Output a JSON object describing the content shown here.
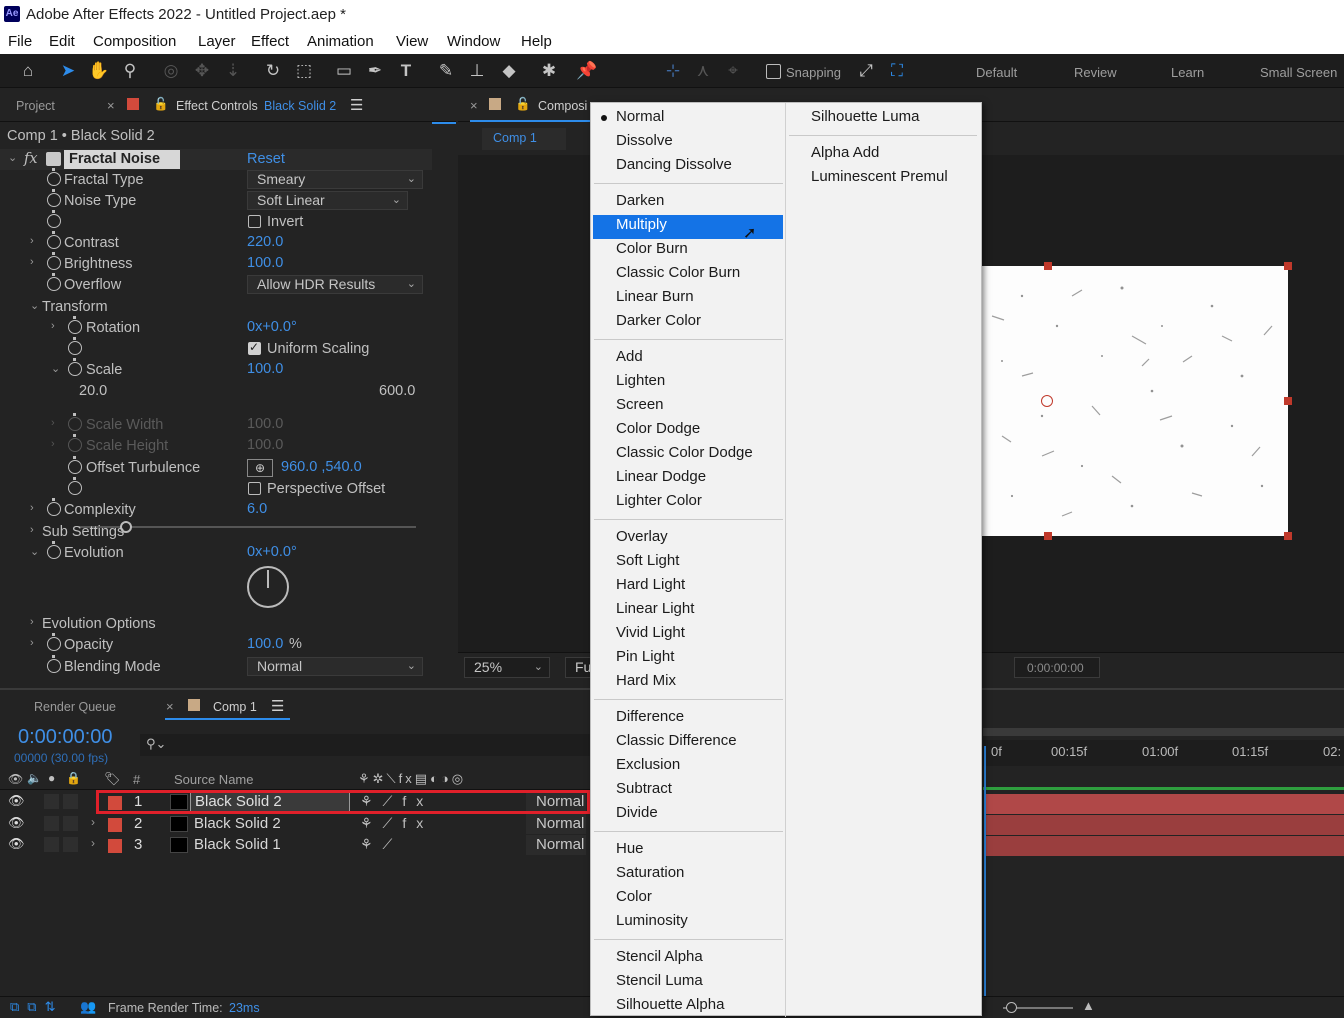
{
  "app": {
    "title": "Adobe After Effects 2022 - Untitled Project.aep *",
    "logo": "Ae"
  },
  "menubar": [
    "File",
    "Edit",
    "Composition",
    "Layer",
    "Effect",
    "Animation",
    "View",
    "Window",
    "Help"
  ],
  "toolbar": {
    "snapping_label": "Snapping",
    "workspaces": [
      "Default",
      "Review",
      "Learn",
      "Small Screen"
    ]
  },
  "left_tabs": {
    "project": "Project",
    "effect_controls": "Effect Controls",
    "effect_controls_layer": "Black Solid 2"
  },
  "comp_tabs": {
    "composition": "Composi",
    "comp1": "Comp 1"
  },
  "effect_controls": {
    "breadcrumb": "Comp 1 • Black Solid 2",
    "effect_name": "Fractal Noise",
    "reset": "Reset",
    "fractal_type": {
      "label": "Fractal Type",
      "value": "Smeary"
    },
    "noise_type": {
      "label": "Noise Type",
      "value": "Soft Linear"
    },
    "invert": {
      "label": "Invert",
      "checked": false
    },
    "contrast": {
      "label": "Contrast",
      "value": "220.0"
    },
    "brightness": {
      "label": "Brightness",
      "value": "100.0"
    },
    "overflow": {
      "label": "Overflow",
      "value": "Allow HDR Results"
    },
    "transform": {
      "label": "Transform"
    },
    "rotation": {
      "label": "Rotation",
      "value": "0x+0.0°"
    },
    "uniform_scaling": {
      "label": "Uniform Scaling",
      "checked": true
    },
    "scale": {
      "label": "Scale",
      "value": "100.0",
      "min": "20.0",
      "max": "600.0",
      "level": 0.14
    },
    "scale_width": {
      "label": "Scale Width",
      "value": "100.0"
    },
    "scale_height": {
      "label": "Scale Height",
      "value": "100.0"
    },
    "offset_turbulence": {
      "label": "Offset Turbulence",
      "value": "960.0 ,540.0"
    },
    "perspective_offset": {
      "label": "Perspective Offset",
      "checked": false
    },
    "complexity": {
      "label": "Complexity",
      "value": "6.0"
    },
    "sub_settings": {
      "label": "Sub Settings"
    },
    "evolution": {
      "label": "Evolution",
      "value": "0x+0.0°"
    },
    "evolution_options": {
      "label": "Evolution Options"
    },
    "opacity": {
      "label": "Opacity",
      "value": "100.0",
      "unit": "%"
    },
    "blending_mode": {
      "label": "Blending Mode",
      "value": "Normal"
    }
  },
  "viewer": {
    "zoom": "25%",
    "resolution": "Ful",
    "timecode": "0:00:00:00"
  },
  "timeline": {
    "tabs": {
      "render_queue": "Render Queue",
      "comp1": "Comp 1"
    },
    "timecode": "0:00:00:00",
    "frames": "00000 (30.00 fps)",
    "col_hash": "#",
    "col_source": "Source Name",
    "layers": [
      {
        "num": "1",
        "name": "Black Solid 2",
        "mode": "Normal"
      },
      {
        "num": "2",
        "name": "Black Solid 2",
        "mode": "Normal"
      },
      {
        "num": "3",
        "name": "Black Solid 1",
        "mode": "Normal"
      }
    ],
    "ruler": [
      "0f",
      "00:15f",
      "01:00f",
      "01:15f",
      "02:"
    ],
    "footer": {
      "label": "Frame Render Time:",
      "value": "23ms"
    }
  },
  "blend_menu": {
    "col1": [
      [
        "Normal",
        "Dissolve",
        "Dancing Dissolve"
      ],
      [
        "Darken",
        "Multiply",
        "Color Burn",
        "Classic Color Burn",
        "Linear Burn",
        "Darker Color"
      ],
      [
        "Add",
        "Lighten",
        "Screen",
        "Color Dodge",
        "Classic Color Dodge",
        "Linear Dodge",
        "Lighter Color"
      ],
      [
        "Overlay",
        "Soft Light",
        "Hard Light",
        "Linear Light",
        "Vivid Light",
        "Pin Light",
        "Hard Mix"
      ],
      [
        "Difference",
        "Classic Difference",
        "Exclusion",
        "Subtract",
        "Divide"
      ],
      [
        "Hue",
        "Saturation",
        "Color",
        "Luminosity"
      ],
      [
        "Stencil Alpha",
        "Stencil Luma",
        "Silhouette Alpha"
      ]
    ],
    "col2": [
      [
        "Silhouette Luma"
      ],
      [
        "Alpha Add",
        "Luminescent Premul"
      ]
    ],
    "selected": "Normal",
    "highlighted": "Multiply"
  },
  "colors": {
    "accent": "#3f8fe6",
    "highlight": "#1473e6",
    "layer_label": "#d24a3c",
    "comp_tab": "#c8a985",
    "track": "#b04848",
    "selection_box": "#e0202a"
  }
}
